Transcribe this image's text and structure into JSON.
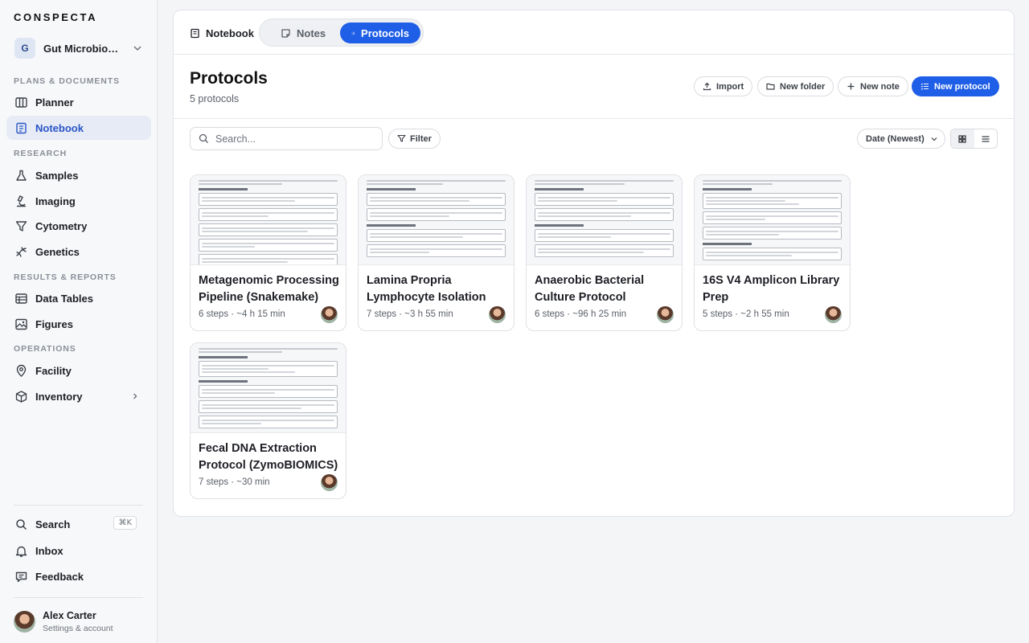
{
  "app": {
    "logo": "CONSPECTA"
  },
  "workspace": {
    "initial": "G",
    "name": "Gut Microbiome Lab"
  },
  "sidebar": {
    "sections": [
      {
        "label": "PLANS & DOCUMENTS"
      },
      {
        "label": "RESEARCH"
      },
      {
        "label": "RESULTS & REPORTS"
      },
      {
        "label": "OPERATIONS"
      }
    ],
    "items": [
      {
        "label": "Planner",
        "icon": "columns-icon"
      },
      {
        "label": "Notebook",
        "icon": "notebook-icon"
      },
      {
        "label": "Samples",
        "icon": "flask-icon"
      },
      {
        "label": "Imaging",
        "icon": "microscope-icon"
      },
      {
        "label": "Cytometry",
        "icon": "funnel-icon"
      },
      {
        "label": "Genetics",
        "icon": "dna-icon"
      },
      {
        "label": "Data Tables",
        "icon": "table-icon"
      },
      {
        "label": "Figures",
        "icon": "image-icon"
      },
      {
        "label": "Facility",
        "icon": "location-pin-icon"
      },
      {
        "label": "Inventory",
        "icon": "box-icon"
      }
    ],
    "bottom": [
      {
        "label": "Search",
        "shortcut": "⌘K"
      },
      {
        "label": "Inbox"
      },
      {
        "label": "Feedback"
      }
    ],
    "user": {
      "name": "Alex Carter",
      "subtitle": "Settings & account"
    }
  },
  "tabs": {
    "notebook": "Notebook",
    "notes": "Notes",
    "protocols": "Protocols"
  },
  "header": {
    "title": "Protocols",
    "subtitle": "5 protocols",
    "import_label": "Import",
    "new_folder_label": "New folder",
    "new_note_label": "New note",
    "new_protocol_label": "New protocol"
  },
  "toolbar": {
    "search_placeholder": "Search...",
    "filter_label": "Filter",
    "sort_label": "Date (Newest)"
  },
  "cards": [
    {
      "title": "Metagenomic Processing Pipeline (Snakemake)",
      "meta": "6 steps · ~4 h 15 min"
    },
    {
      "title": "Lamina Propria Lymphocyte Isolation an…",
      "meta": "7 steps · ~3 h 55 min"
    },
    {
      "title": "Anaerobic Bacterial Culture Protocol",
      "meta": "6 steps · ~96 h 25 min"
    },
    {
      "title": "16S V4 Amplicon Library Prep",
      "meta": "5 steps · ~2 h 55 min"
    },
    {
      "title": "Fecal DNA Extraction Protocol (ZymoBIOMICS)",
      "meta": "7 steps · ~30 min"
    }
  ],
  "colors": {
    "accent": "#1f5ee6",
    "active_nav_bg": "#e6ebf5",
    "active_nav_text": "#2a55c8"
  }
}
